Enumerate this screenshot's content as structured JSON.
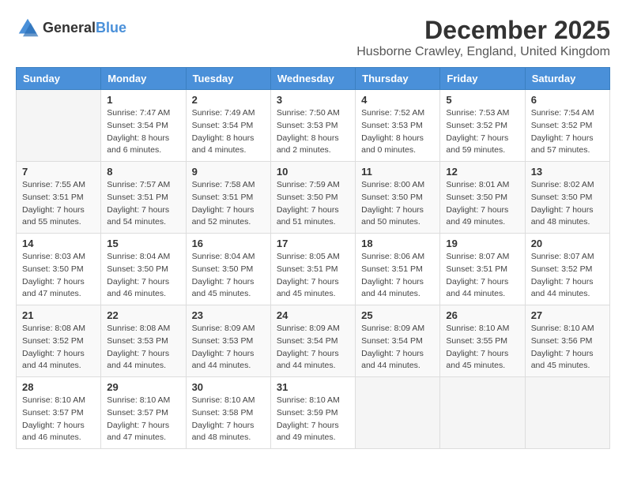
{
  "header": {
    "logo_general": "General",
    "logo_blue": "Blue",
    "month": "December 2025",
    "location": "Husborne Crawley, England, United Kingdom"
  },
  "days_of_week": [
    "Sunday",
    "Monday",
    "Tuesday",
    "Wednesday",
    "Thursday",
    "Friday",
    "Saturday"
  ],
  "weeks": [
    [
      {
        "day": "",
        "sunrise": "",
        "sunset": "",
        "daylight": ""
      },
      {
        "day": "1",
        "sunrise": "Sunrise: 7:47 AM",
        "sunset": "Sunset: 3:54 PM",
        "daylight": "Daylight: 8 hours and 6 minutes."
      },
      {
        "day": "2",
        "sunrise": "Sunrise: 7:49 AM",
        "sunset": "Sunset: 3:54 PM",
        "daylight": "Daylight: 8 hours and 4 minutes."
      },
      {
        "day": "3",
        "sunrise": "Sunrise: 7:50 AM",
        "sunset": "Sunset: 3:53 PM",
        "daylight": "Daylight: 8 hours and 2 minutes."
      },
      {
        "day": "4",
        "sunrise": "Sunrise: 7:52 AM",
        "sunset": "Sunset: 3:53 PM",
        "daylight": "Daylight: 8 hours and 0 minutes."
      },
      {
        "day": "5",
        "sunrise": "Sunrise: 7:53 AM",
        "sunset": "Sunset: 3:52 PM",
        "daylight": "Daylight: 7 hours and 59 minutes."
      },
      {
        "day": "6",
        "sunrise": "Sunrise: 7:54 AM",
        "sunset": "Sunset: 3:52 PM",
        "daylight": "Daylight: 7 hours and 57 minutes."
      }
    ],
    [
      {
        "day": "7",
        "sunrise": "Sunrise: 7:55 AM",
        "sunset": "Sunset: 3:51 PM",
        "daylight": "Daylight: 7 hours and 55 minutes."
      },
      {
        "day": "8",
        "sunrise": "Sunrise: 7:57 AM",
        "sunset": "Sunset: 3:51 PM",
        "daylight": "Daylight: 7 hours and 54 minutes."
      },
      {
        "day": "9",
        "sunrise": "Sunrise: 7:58 AM",
        "sunset": "Sunset: 3:51 PM",
        "daylight": "Daylight: 7 hours and 52 minutes."
      },
      {
        "day": "10",
        "sunrise": "Sunrise: 7:59 AM",
        "sunset": "Sunset: 3:50 PM",
        "daylight": "Daylight: 7 hours and 51 minutes."
      },
      {
        "day": "11",
        "sunrise": "Sunrise: 8:00 AM",
        "sunset": "Sunset: 3:50 PM",
        "daylight": "Daylight: 7 hours and 50 minutes."
      },
      {
        "day": "12",
        "sunrise": "Sunrise: 8:01 AM",
        "sunset": "Sunset: 3:50 PM",
        "daylight": "Daylight: 7 hours and 49 minutes."
      },
      {
        "day": "13",
        "sunrise": "Sunrise: 8:02 AM",
        "sunset": "Sunset: 3:50 PM",
        "daylight": "Daylight: 7 hours and 48 minutes."
      }
    ],
    [
      {
        "day": "14",
        "sunrise": "Sunrise: 8:03 AM",
        "sunset": "Sunset: 3:50 PM",
        "daylight": "Daylight: 7 hours and 47 minutes."
      },
      {
        "day": "15",
        "sunrise": "Sunrise: 8:04 AM",
        "sunset": "Sunset: 3:50 PM",
        "daylight": "Daylight: 7 hours and 46 minutes."
      },
      {
        "day": "16",
        "sunrise": "Sunrise: 8:04 AM",
        "sunset": "Sunset: 3:50 PM",
        "daylight": "Daylight: 7 hours and 45 minutes."
      },
      {
        "day": "17",
        "sunrise": "Sunrise: 8:05 AM",
        "sunset": "Sunset: 3:51 PM",
        "daylight": "Daylight: 7 hours and 45 minutes."
      },
      {
        "day": "18",
        "sunrise": "Sunrise: 8:06 AM",
        "sunset": "Sunset: 3:51 PM",
        "daylight": "Daylight: 7 hours and 44 minutes."
      },
      {
        "day": "19",
        "sunrise": "Sunrise: 8:07 AM",
        "sunset": "Sunset: 3:51 PM",
        "daylight": "Daylight: 7 hours and 44 minutes."
      },
      {
        "day": "20",
        "sunrise": "Sunrise: 8:07 AM",
        "sunset": "Sunset: 3:52 PM",
        "daylight": "Daylight: 7 hours and 44 minutes."
      }
    ],
    [
      {
        "day": "21",
        "sunrise": "Sunrise: 8:08 AM",
        "sunset": "Sunset: 3:52 PM",
        "daylight": "Daylight: 7 hours and 44 minutes."
      },
      {
        "day": "22",
        "sunrise": "Sunrise: 8:08 AM",
        "sunset": "Sunset: 3:53 PM",
        "daylight": "Daylight: 7 hours and 44 minutes."
      },
      {
        "day": "23",
        "sunrise": "Sunrise: 8:09 AM",
        "sunset": "Sunset: 3:53 PM",
        "daylight": "Daylight: 7 hours and 44 minutes."
      },
      {
        "day": "24",
        "sunrise": "Sunrise: 8:09 AM",
        "sunset": "Sunset: 3:54 PM",
        "daylight": "Daylight: 7 hours and 44 minutes."
      },
      {
        "day": "25",
        "sunrise": "Sunrise: 8:09 AM",
        "sunset": "Sunset: 3:54 PM",
        "daylight": "Daylight: 7 hours and 44 minutes."
      },
      {
        "day": "26",
        "sunrise": "Sunrise: 8:10 AM",
        "sunset": "Sunset: 3:55 PM",
        "daylight": "Daylight: 7 hours and 45 minutes."
      },
      {
        "day": "27",
        "sunrise": "Sunrise: 8:10 AM",
        "sunset": "Sunset: 3:56 PM",
        "daylight": "Daylight: 7 hours and 45 minutes."
      }
    ],
    [
      {
        "day": "28",
        "sunrise": "Sunrise: 8:10 AM",
        "sunset": "Sunset: 3:57 PM",
        "daylight": "Daylight: 7 hours and 46 minutes."
      },
      {
        "day": "29",
        "sunrise": "Sunrise: 8:10 AM",
        "sunset": "Sunset: 3:57 PM",
        "daylight": "Daylight: 7 hours and 47 minutes."
      },
      {
        "day": "30",
        "sunrise": "Sunrise: 8:10 AM",
        "sunset": "Sunset: 3:58 PM",
        "daylight": "Daylight: 7 hours and 48 minutes."
      },
      {
        "day": "31",
        "sunrise": "Sunrise: 8:10 AM",
        "sunset": "Sunset: 3:59 PM",
        "daylight": "Daylight: 7 hours and 49 minutes."
      },
      {
        "day": "",
        "sunrise": "",
        "sunset": "",
        "daylight": ""
      },
      {
        "day": "",
        "sunrise": "",
        "sunset": "",
        "daylight": ""
      },
      {
        "day": "",
        "sunrise": "",
        "sunset": "",
        "daylight": ""
      }
    ]
  ]
}
